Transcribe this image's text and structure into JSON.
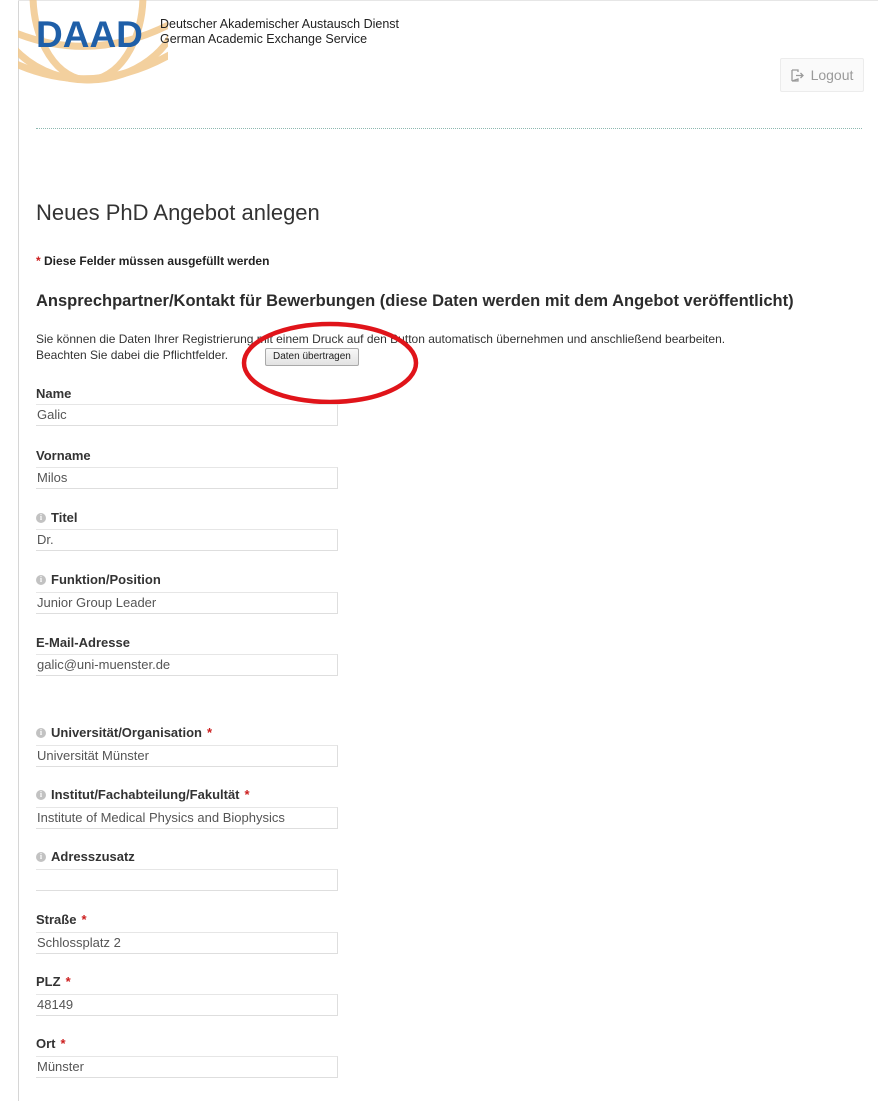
{
  "header": {
    "logo": "DAAD",
    "org_name_de": "Deutscher Akademischer Austausch Dienst",
    "org_name_en": "German Academic Exchange Service",
    "logout_label": "Logout",
    "logout_icon": "logout-icon"
  },
  "page": {
    "title": "Neues PhD Angebot anlegen",
    "required_note_star": "*",
    "required_note": "Diese Felder müssen ausgefüllt werden"
  },
  "section": {
    "heading": "Ansprechpartner/Kontakt für Bewerbungen (diese Daten werden mit dem Angebot veröffentlicht)",
    "info_line1": "Sie können die Daten Ihrer Registrierung mit einem Druck auf den Button automatisch übernehmen und anschließend bearbeiten.",
    "info_line2": "Beachten Sie dabei die Pflichtfelder.",
    "transfer_button": "Daten übertragen"
  },
  "colors": {
    "brand_blue": "#1f5fa8",
    "required_red": "#cc1d1d",
    "annotation_red": "#e0141a"
  },
  "fields": [
    {
      "label": "Name",
      "value": "Galic",
      "info": false,
      "required": false
    },
    {
      "label": "Vorname",
      "value": "Milos",
      "info": false,
      "required": false
    },
    {
      "label": "Titel",
      "value": "Dr.",
      "info": true,
      "required": false
    },
    {
      "label": "Funktion/Position",
      "value": "Junior Group Leader",
      "info": true,
      "required": false
    },
    {
      "label": "E-Mail-Adresse",
      "value": "galic@uni-muenster.de",
      "info": false,
      "required": false
    },
    {
      "label": "Universität/Organisation",
      "value": "Universität Münster",
      "info": true,
      "required": true
    },
    {
      "label": "Institut/Fachabteilung/Fakultät",
      "value": "Institute of Medical Physics and Biophysics",
      "info": true,
      "required": true
    },
    {
      "label": "Adresszusatz",
      "value": "",
      "info": true,
      "required": false
    },
    {
      "label": "Straße",
      "value": "Schlossplatz 2",
      "info": false,
      "required": true
    },
    {
      "label": "PLZ",
      "value": "48149",
      "info": false,
      "required": true
    },
    {
      "label": "Ort",
      "value": "Münster",
      "info": false,
      "required": true
    }
  ]
}
